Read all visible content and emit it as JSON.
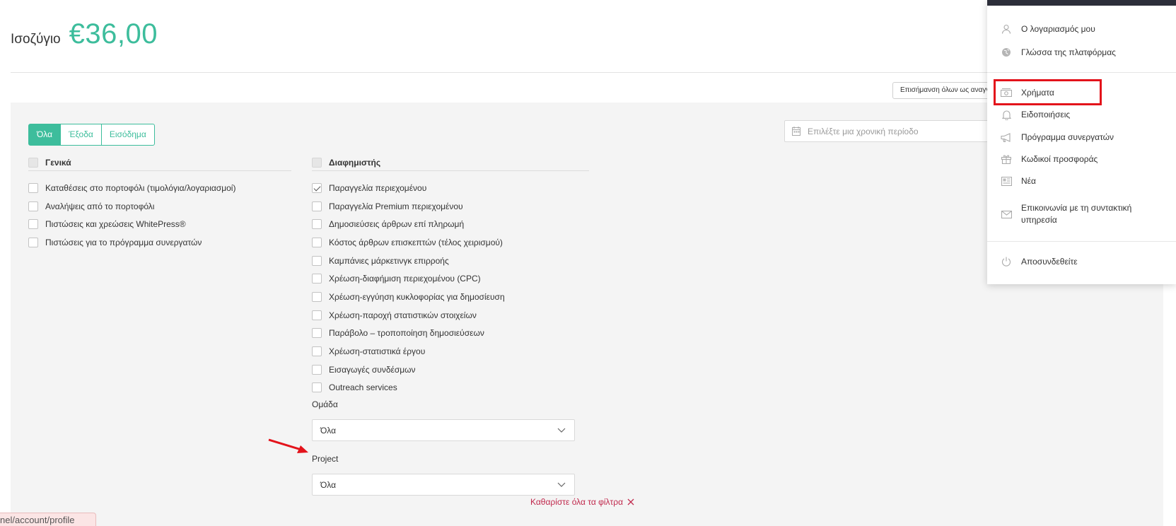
{
  "balance": {
    "label": "Ισοζύγιο",
    "amount": "€36,00"
  },
  "toolbar": {
    "mark_all_label": "Επισήμανση όλων ως αναγνωσμένων"
  },
  "filters": {
    "segments": [
      "Όλα",
      "Έξοδα",
      "Εισόδημα"
    ],
    "active_segment": "Όλα",
    "date_placeholder": "Επιλέξτε μια χρονική περίοδο",
    "general": {
      "title": "Γενικά",
      "options": [
        {
          "label": "Καταθέσεις στο πορτοφόλι (τιμολόγια/λογαριασμοί)",
          "checked": false
        },
        {
          "label": "Αναλήψεις από το πορτοφόλι",
          "checked": false
        },
        {
          "label": "Πιστώσεις και χρεώσεις WhitePress®",
          "checked": false
        },
        {
          "label": "Πιστώσεις για το πρόγραμμα συνεργατών",
          "checked": false
        }
      ]
    },
    "advertiser": {
      "title": "Διαφημιστής",
      "options": [
        {
          "label": "Παραγγελία περιεχομένου",
          "checked": true
        },
        {
          "label": "Παραγγελία Premium περιεχομένου",
          "checked": false
        },
        {
          "label": "Δημοσιεύσεις άρθρων επί πληρωμή",
          "checked": false
        },
        {
          "label": "Κόστος άρθρων επισκεπτών (τέλος χειρισμού)",
          "checked": false
        },
        {
          "label": "Καμπάνιες μάρκετινγκ επιρροής",
          "checked": false
        },
        {
          "label": "Χρέωση-διαφήμιση περιεχομένου (CPC)",
          "checked": false
        },
        {
          "label": "Χρέωση-εγγύηση κυκλοφορίας για δημοσίευση",
          "checked": false
        },
        {
          "label": "Χρέωση-παροχή στατιστικών στοιχείων",
          "checked": false
        },
        {
          "label": "Παράβολο – τροποποίηση δημοσιεύσεων",
          "checked": false
        },
        {
          "label": "Χρέωση-στατιστικά έργου",
          "checked": false
        },
        {
          "label": "Εισαγωγές συνδέσμων",
          "checked": false
        },
        {
          "label": "Outreach services",
          "checked": false
        }
      ]
    },
    "group": {
      "label": "Ομάδα",
      "value": "Όλα"
    },
    "project": {
      "label": "Project",
      "value": "Όλα"
    },
    "clear_label": "Καθαρίστε όλα τα φίλτρα"
  },
  "status_bar": {
    "url": "nel/account/profile"
  },
  "menu": {
    "items": [
      {
        "label": "Ο λογαριασμός μου",
        "icon": "user-icon"
      },
      {
        "label": "Γλώσσα της πλατφόρμας",
        "icon": "globe-icon"
      },
      {
        "label": "Χρήματα",
        "icon": "money-icon",
        "highlighted": true
      },
      {
        "label": "Ειδοποιήσεις",
        "icon": "bell-icon"
      },
      {
        "label": "Πρόγραμμα συνεργατών",
        "icon": "megaphone-icon"
      },
      {
        "label": "Κωδικοί προσφοράς",
        "icon": "gift-icon"
      },
      {
        "label": "Νέα",
        "icon": "news-icon"
      },
      {
        "label": "Επικοινωνία με τη συντακτική υπηρεσία",
        "icon": "mail-icon"
      },
      {
        "label": "Αποσυνδεθείτε",
        "icon": "power-icon"
      }
    ]
  },
  "colors": {
    "accent": "#3dbd9c",
    "danger": "#c0284c",
    "highlight": "#e3131b"
  }
}
